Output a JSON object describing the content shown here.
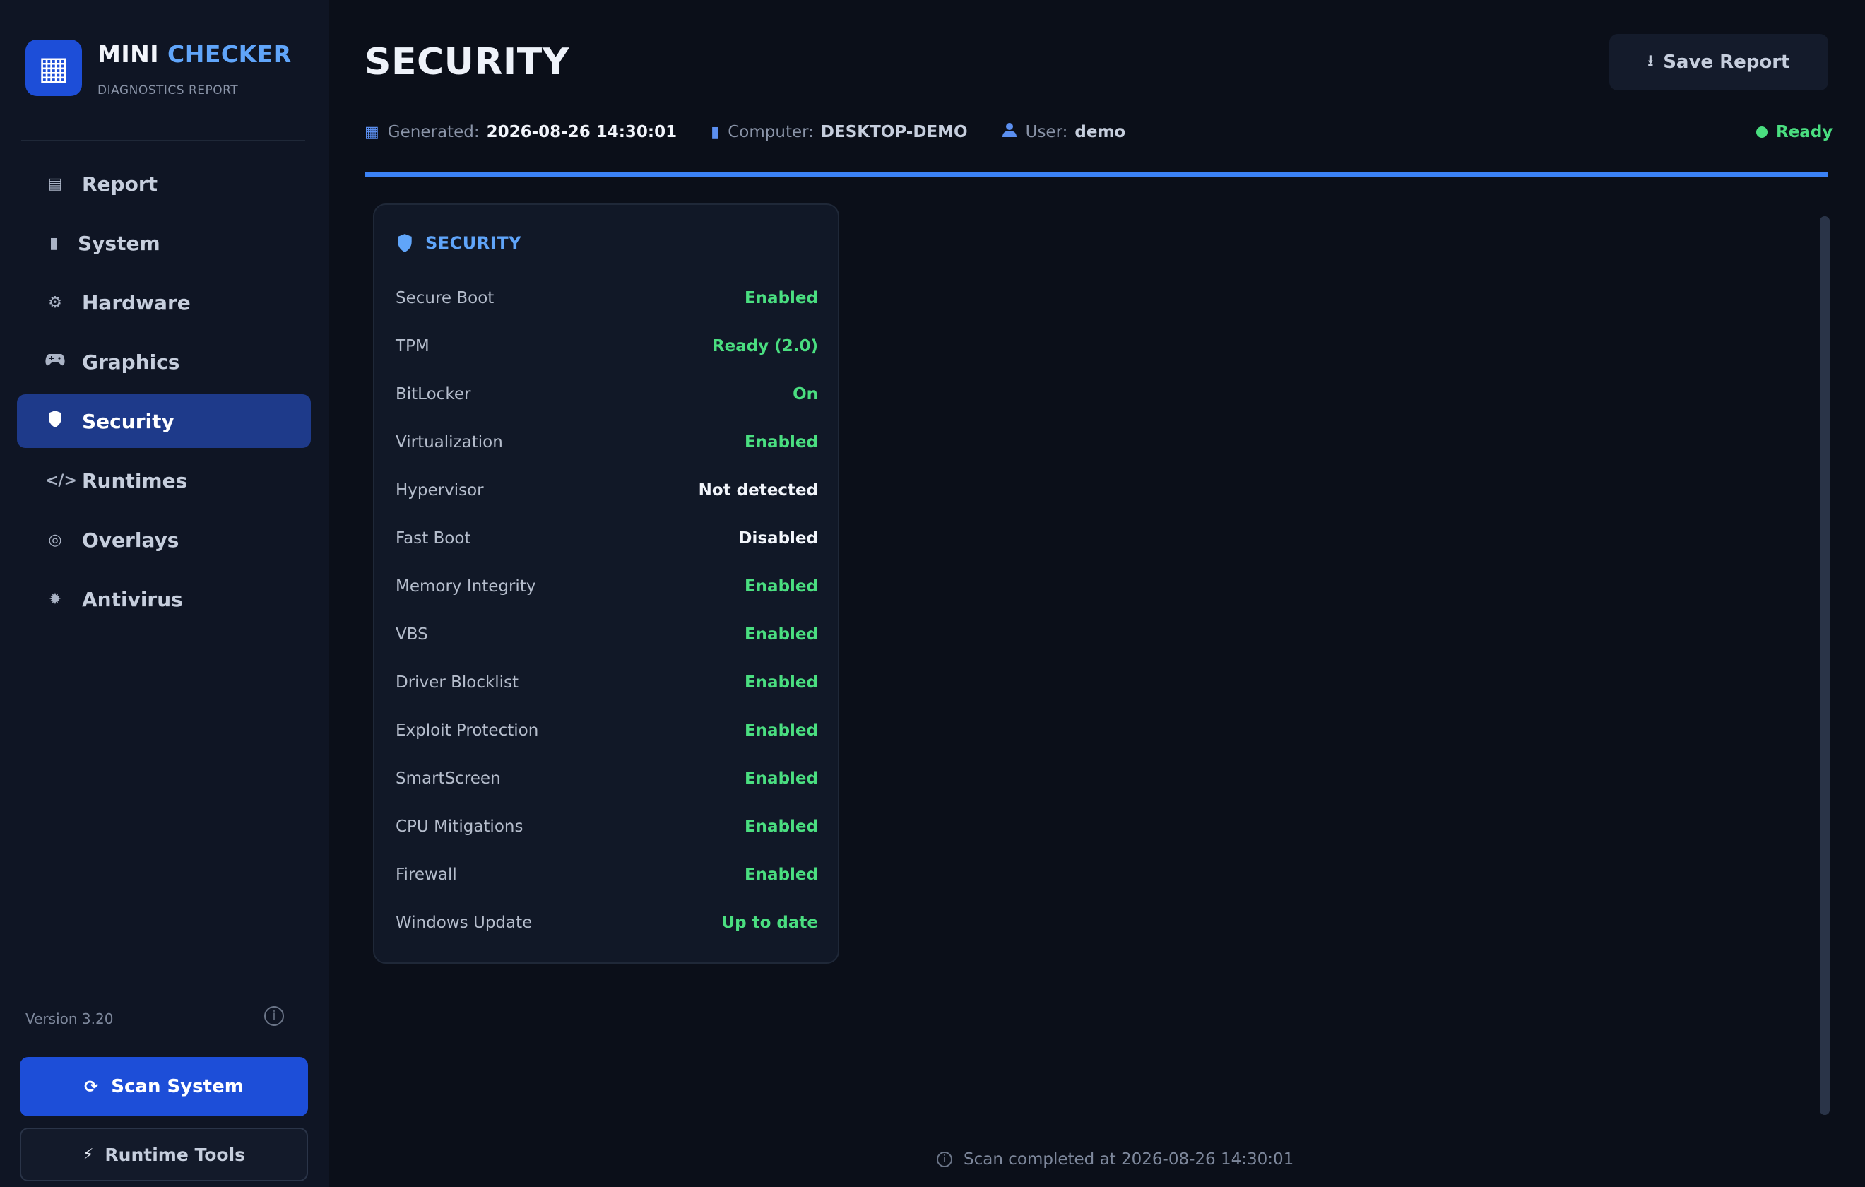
{
  "brand": {
    "title_part1": "MINI",
    "title_part2": "CHECKER",
    "subtitle": "DIAGNOSTICS REPORT",
    "logo_icon": "grid-icon"
  },
  "sidebar": {
    "items": [
      {
        "label": "Report",
        "icon": "document-icon"
      },
      {
        "label": "System",
        "icon": "computer-tower-icon"
      },
      {
        "label": "Hardware",
        "icon": "gear-icon"
      },
      {
        "label": "Graphics",
        "icon": "gamepad-icon"
      },
      {
        "label": "Security",
        "icon": "shield-icon",
        "active": true
      },
      {
        "label": "Runtimes",
        "icon": "code-icon"
      },
      {
        "label": "Overlays",
        "icon": "target-icon"
      },
      {
        "label": "Antivirus",
        "icon": "bug-icon"
      }
    ],
    "version": "Version 3.20",
    "scan_button": "Scan System",
    "runtime_button": "Runtime Tools"
  },
  "header": {
    "title": "SECURITY",
    "save_button": "Save Report",
    "generated_label": "Generated:",
    "generated_value": "2026-08-26 14:30:01",
    "computer_label": "Computer:",
    "computer_value": "DESKTOP-DEMO",
    "user_label": "User:",
    "user_value": "demo",
    "status": "Ready",
    "progress": 1.0
  },
  "card": {
    "title": "SECURITY",
    "rows": [
      {
        "key": "Secure Boot",
        "value": "Enabled",
        "tone": "green"
      },
      {
        "key": "TPM",
        "value": "Ready (2.0)",
        "tone": "green"
      },
      {
        "key": "BitLocker",
        "value": "On",
        "tone": "green"
      },
      {
        "key": "Virtualization",
        "value": "Enabled",
        "tone": "green"
      },
      {
        "key": "Hypervisor",
        "value": "Not detected",
        "tone": "white"
      },
      {
        "key": "Fast Boot",
        "value": "Disabled",
        "tone": "white"
      },
      {
        "key": "Memory Integrity",
        "value": "Enabled",
        "tone": "green"
      },
      {
        "key": "VBS",
        "value": "Enabled",
        "tone": "green"
      },
      {
        "key": "Driver Blocklist",
        "value": "Enabled",
        "tone": "green"
      },
      {
        "key": "Exploit Protection",
        "value": "Enabled",
        "tone": "green"
      },
      {
        "key": "SmartScreen",
        "value": "Enabled",
        "tone": "green"
      },
      {
        "key": "CPU Mitigations",
        "value": "Enabled",
        "tone": "green"
      },
      {
        "key": "Firewall",
        "value": "Enabled",
        "tone": "green"
      },
      {
        "key": "Windows Update",
        "value": "Up to date",
        "tone": "green"
      }
    ]
  },
  "footer": {
    "text": "Scan completed at 2026-08-26 14:30:01"
  },
  "colors": {
    "accent": "#3b82f6",
    "active_nav": "#1e3a8a",
    "ok": "#4ade80",
    "background": "#0b0f19"
  }
}
